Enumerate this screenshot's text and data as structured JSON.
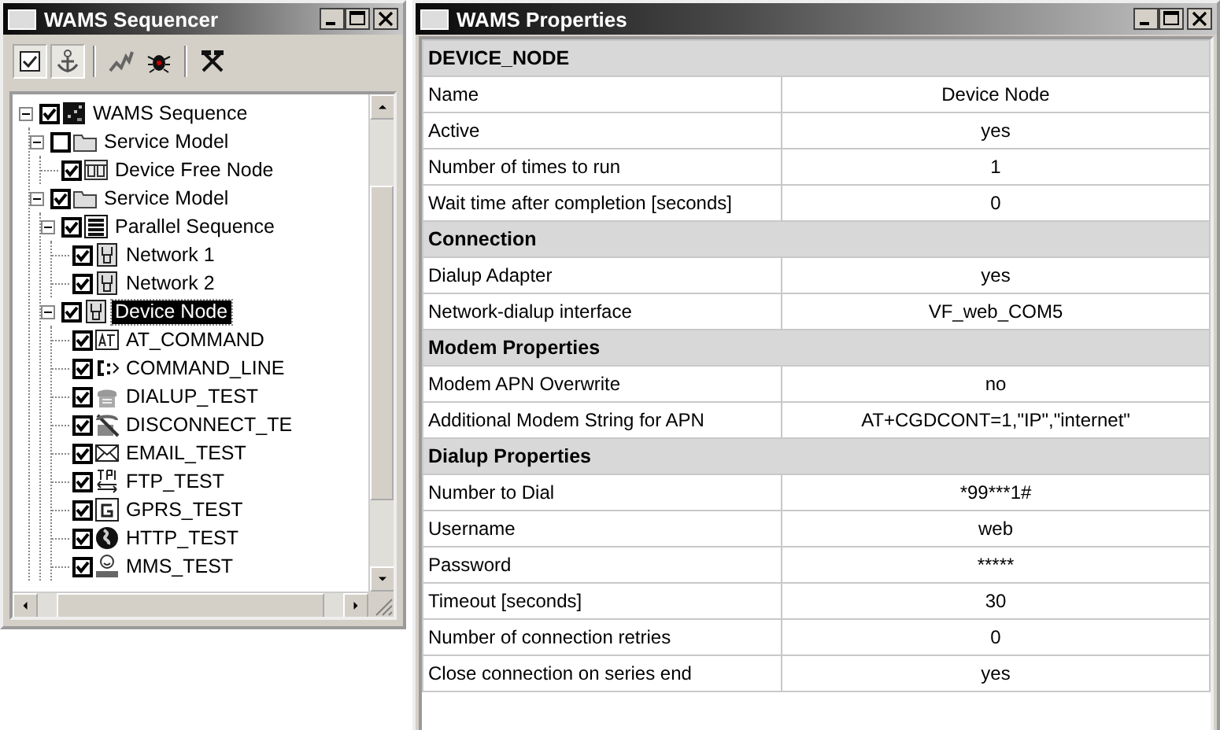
{
  "sequencer": {
    "title": "WAMS Sequencer",
    "toolbar": [
      {
        "kind": "checkbox",
        "pressed": true
      },
      {
        "kind": "anchor",
        "pressed": true
      },
      {
        "kind": "chart",
        "pressed": false
      },
      {
        "kind": "bug",
        "pressed": false
      },
      {
        "kind": "tools",
        "pressed": false
      }
    ],
    "tree": [
      {
        "label": "WAMS Sequence",
        "kind": "sequence",
        "checked": true,
        "expanded": true,
        "selected": false,
        "children": [
          {
            "label": "Service Model",
            "kind": "folder",
            "checked": false,
            "expanded": true,
            "selected": false,
            "children": [
              {
                "label": "Device Free Node",
                "kind": "freenode",
                "checked": true,
                "selected": false
              }
            ]
          },
          {
            "label": "Service Model",
            "kind": "folder",
            "checked": true,
            "expanded": true,
            "selected": false,
            "children": [
              {
                "label": "Parallel Sequence",
                "kind": "parallel",
                "checked": true,
                "expanded": true,
                "selected": false,
                "children": [
                  {
                    "label": "Network 1",
                    "kind": "network",
                    "checked": true,
                    "selected": false
                  },
                  {
                    "label": "Network 2",
                    "kind": "network",
                    "checked": true,
                    "selected": false
                  }
                ]
              },
              {
                "label": "Device Node",
                "kind": "network",
                "checked": true,
                "expanded": true,
                "selected": true,
                "children": [
                  {
                    "label": "AT_COMMAND",
                    "kind": "at",
                    "checked": true,
                    "selected": false
                  },
                  {
                    "label": "COMMAND_LINE",
                    "kind": "cmd",
                    "checked": true,
                    "selected": false
                  },
                  {
                    "label": "DIALUP_TEST",
                    "kind": "phone",
                    "checked": true,
                    "selected": false
                  },
                  {
                    "label": "DISCONNECT_TE",
                    "kind": "disconnect",
                    "checked": true,
                    "selected": false
                  },
                  {
                    "label": "EMAIL_TEST",
                    "kind": "mail",
                    "checked": true,
                    "selected": false
                  },
                  {
                    "label": "FTP_TEST",
                    "kind": "ftp",
                    "checked": true,
                    "selected": false
                  },
                  {
                    "label": "GPRS_TEST",
                    "kind": "gprs",
                    "checked": true,
                    "selected": false
                  },
                  {
                    "label": "HTTP_TEST",
                    "kind": "globe",
                    "checked": true,
                    "selected": false
                  },
                  {
                    "label": "MMS_TEST",
                    "kind": "mms",
                    "checked": true,
                    "selected": false
                  }
                ]
              }
            ]
          }
        ]
      }
    ]
  },
  "properties": {
    "title": "WAMS Properties",
    "rows": [
      {
        "kind": "section",
        "label": "DEVICE_NODE"
      },
      {
        "kind": "property",
        "label": "Name",
        "value": "Device Node"
      },
      {
        "kind": "property",
        "label": "Active",
        "value": "yes"
      },
      {
        "kind": "property",
        "label": "Number of times to run",
        "value": "1"
      },
      {
        "kind": "property",
        "label": "Wait time after completion [seconds]",
        "value": "0"
      },
      {
        "kind": "section",
        "label": "Connection"
      },
      {
        "kind": "property",
        "label": "Dialup Adapter",
        "value": "yes"
      },
      {
        "kind": "property",
        "label": "Network-dialup interface",
        "value": "VF_web_COM5"
      },
      {
        "kind": "section",
        "label": "Modem Properties"
      },
      {
        "kind": "property",
        "label": "Modem APN Overwrite",
        "value": "no"
      },
      {
        "kind": "property",
        "label": "Additional Modem String for APN",
        "value": "AT+CGDCONT=1,\"IP\",\"internet\""
      },
      {
        "kind": "section",
        "label": "Dialup Properties"
      },
      {
        "kind": "property",
        "label": "Number to Dial",
        "value": "*99***1#"
      },
      {
        "kind": "property",
        "label": "Username",
        "value": "web"
      },
      {
        "kind": "property",
        "label": "Password",
        "value": "*****"
      },
      {
        "kind": "property",
        "label": "Timeout [seconds]",
        "value": "30"
      },
      {
        "kind": "property",
        "label": "Number of connection retries",
        "value": "0"
      },
      {
        "kind": "property",
        "label": "Close connection on series end",
        "value": "yes"
      }
    ]
  }
}
